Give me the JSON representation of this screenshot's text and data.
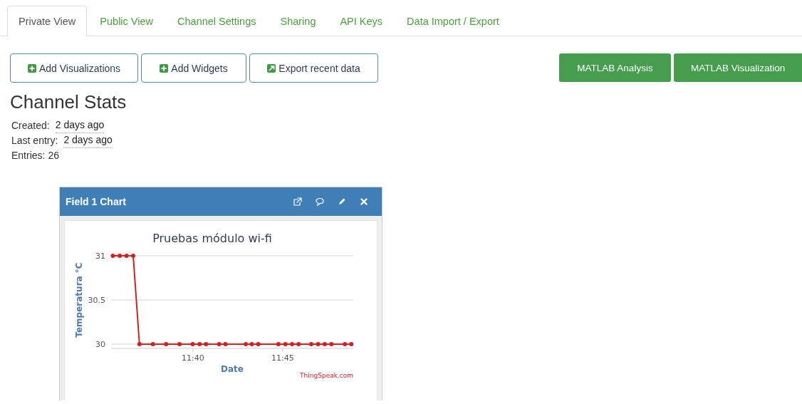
{
  "tabs": [
    {
      "label": "Private View",
      "selected": true
    },
    {
      "label": "Public View",
      "selected": false
    },
    {
      "label": "Channel Settings",
      "selected": false
    },
    {
      "label": "Sharing",
      "selected": false
    },
    {
      "label": "API Keys",
      "selected": false
    },
    {
      "label": "Data Import / Export",
      "selected": false
    }
  ],
  "actions": [
    {
      "label": "Add Visualizations",
      "kind": "add"
    },
    {
      "label": "Add Widgets",
      "kind": "add"
    },
    {
      "label": "Export recent data",
      "kind": "export"
    }
  ],
  "matlab_buttons": [
    "MATLAB Analysis",
    "MATLAB Visualization"
  ],
  "channel_stats": {
    "title": "Channel Stats",
    "rows": [
      {
        "label": "Created:",
        "value": "2 days ago",
        "kind": "time"
      },
      {
        "label": "Last entry:",
        "value": "2 days ago",
        "kind": "time"
      },
      {
        "label": "Entries:",
        "value": "26",
        "kind": "plain"
      }
    ]
  },
  "widget": {
    "title": "Field 1 Chart",
    "credit": "ThingSpeak.com",
    "chart_data": {
      "type": "line",
      "title": "Pruebas módulo wi-fi",
      "xlabel": "Date",
      "ylabel": "Temperatura °C",
      "x": [
        11.5923,
        11.5987,
        11.605,
        11.6112,
        11.617,
        11.6295,
        11.6417,
        11.6542,
        11.6665,
        11.6728,
        11.6788,
        11.691,
        11.6968,
        11.7157,
        11.7213,
        11.7273,
        11.746,
        11.7525,
        11.7587,
        11.7647,
        11.7765,
        11.7828,
        11.789,
        11.7952,
        11.8077,
        11.8137
      ],
      "series": [
        {
          "color": "#d62020",
          "marker": "circle",
          "values": [
            31,
            31,
            31,
            31,
            30,
            30,
            30,
            30,
            30,
            30,
            30,
            30,
            30,
            30,
            30,
            30,
            30,
            30,
            30,
            30,
            30,
            30,
            30,
            30,
            30,
            30
          ]
        }
      ],
      "xlim": [
        11.5907,
        11.8155
      ],
      "ylim": [
        30,
        31
      ],
      "xticks": [
        {
          "value": 11.6667,
          "label": "11:40"
        },
        {
          "value": 11.75,
          "label": "11:45"
        }
      ],
      "yticks": [
        {
          "value": 30,
          "label": "30"
        },
        {
          "value": 30.5,
          "label": "30.5"
        },
        {
          "value": 31,
          "label": "31"
        }
      ]
    }
  }
}
